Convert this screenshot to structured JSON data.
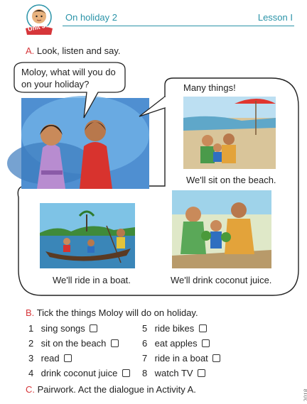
{
  "header": {
    "unit_label": "Unit 37",
    "title": "On holiday 2",
    "lesson": "Lesson I"
  },
  "section_a": {
    "letter": "A.",
    "instruction": "Look, listen and say.",
    "bubble_question_line1": "Moloy, what will you do",
    "bubble_question_line2": "on your holiday?",
    "bubble_answer": "Many things!",
    "caption_beach": "We'll sit on the beach.",
    "caption_boat": "We'll ride in a boat.",
    "caption_coconut": "We'll drink coconut juice."
  },
  "section_b": {
    "letter": "B.",
    "instruction": "Tick the things Moloy will do on holiday.",
    "left_items": [
      {
        "num": "1",
        "text": "sing songs"
      },
      {
        "num": "2",
        "text": "sit on the beach"
      },
      {
        "num": "3",
        "text": "read"
      },
      {
        "num": "4",
        "text": "drink coconut juice"
      }
    ],
    "right_items": [
      {
        "num": "5",
        "text": "ride bikes"
      },
      {
        "num": "6",
        "text": "eat apples"
      },
      {
        "num": "7",
        "text": "ride in a boat"
      },
      {
        "num": "8",
        "text": "watch TV"
      }
    ]
  },
  "section_c": {
    "letter": "C.",
    "instruction": "Pairwork. Act the dialogue in Activity A."
  },
  "footer": {
    "year": "2018"
  },
  "colors": {
    "accent": "#2a93a8",
    "section_letter": "#d6363a"
  }
}
